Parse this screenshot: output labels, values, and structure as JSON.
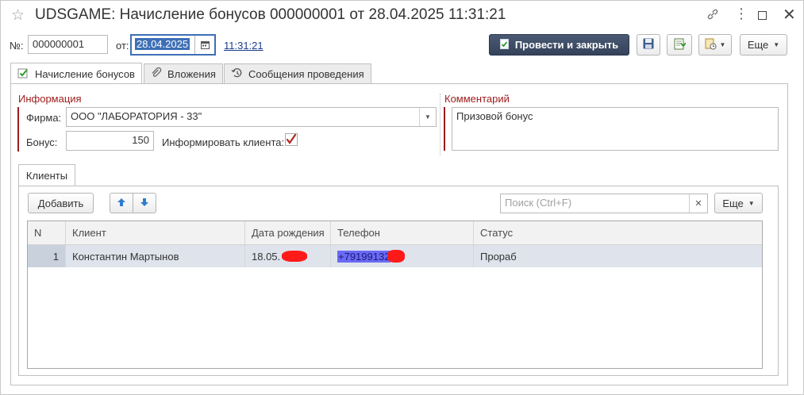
{
  "window": {
    "title": "UDSGAME: Начисление бонусов 000000001 от 28.04.2025 11:31:21"
  },
  "header": {
    "number_label": "№:",
    "number_value": "000000001",
    "date_label": "от:",
    "date_value": "28.04.2025",
    "time_value": "11:31:21",
    "post_close_label": "Провести и закрыть",
    "more_label": "Еще"
  },
  "tabs": [
    {
      "label": "Начисление бонусов"
    },
    {
      "label": "Вложения"
    },
    {
      "label": "Сообщения проведения"
    }
  ],
  "info": {
    "section_title": "Информация",
    "firm_label": "Фирма:",
    "firm_value": "ООО \"ЛАБОРАТОРИЯ - 33\"",
    "bonus_label": "Бонус:",
    "bonus_value": "150",
    "inform_label": "Информировать клиента:",
    "inform_checked": true
  },
  "comment": {
    "section_title": "Комментарий",
    "value": "Призовой бонус"
  },
  "clients": {
    "tab_label": "Клиенты",
    "add_label": "Добавить",
    "search_placeholder": "Поиск (Ctrl+F)",
    "more_label": "Еще",
    "columns": [
      "N",
      "Клиент",
      "Дата рождения",
      "Телефон",
      "Статус"
    ],
    "rows": [
      {
        "n": "1",
        "client": "Константин Мартынов",
        "birth": "18.05.",
        "phone": "+79199132",
        "status": "Прораб"
      }
    ]
  },
  "colors": {
    "accent_red": "#9c1b1b",
    "primary_button": "#3b4a63",
    "selected_row": "#dfe4ec"
  }
}
